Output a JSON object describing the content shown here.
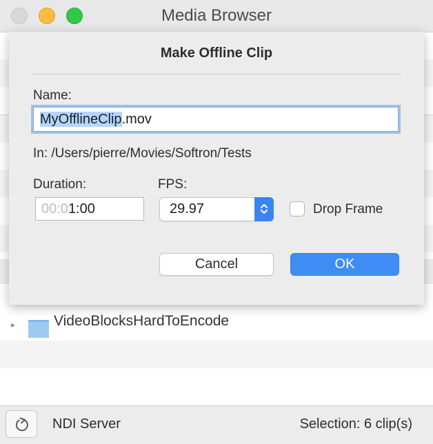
{
  "window": {
    "title": "Media Browser"
  },
  "background_list": {
    "partial_folder_name": "VideoBlocksHardToEncode"
  },
  "dialog": {
    "title": "Make Offline Clip",
    "name_label": "Name:",
    "name_value_selected": "MyOfflineClip",
    "name_value_rest": ".mov",
    "location_text": "In: /Users/pierre/Movies/Softron/Tests",
    "duration_label": "Duration:",
    "duration_dim": "00:0",
    "duration_value": "1:00",
    "fps_label": "FPS:",
    "fps_value": "29.97",
    "drop_frame_label": "Drop Frame",
    "drop_frame_checked": false,
    "cancel_label": "Cancel",
    "ok_label": "OK"
  },
  "bottom_bar": {
    "refresh_icon": "refresh-icon",
    "server_label": "NDI Server",
    "selection_label": "Selection: 6 clip(s)"
  },
  "colors": {
    "accent": "#3f8cf4",
    "selection_highlight": "#b4d5fe",
    "close_button": "#d8d8d8",
    "minimize_button": "#fdbc40",
    "zoom_button": "#34c84a"
  }
}
